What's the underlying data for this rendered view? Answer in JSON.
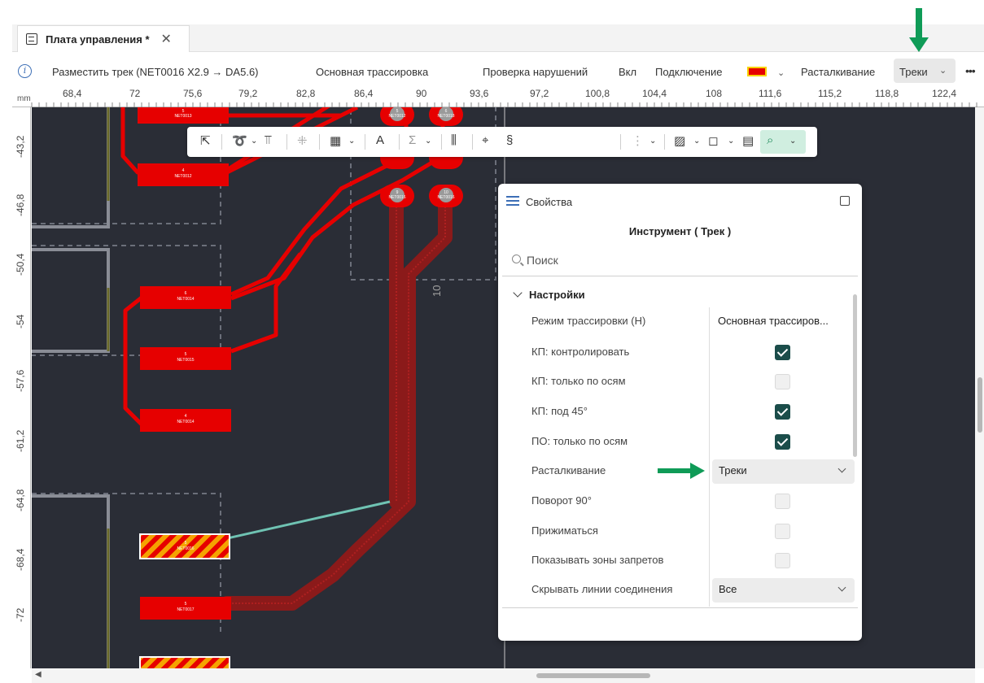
{
  "tab": {
    "title": "Плата управления *",
    "close": "✕",
    "icon": "board-document-icon"
  },
  "toolbar": {
    "info_icon": "i",
    "place_track": "Разместить трек (NET0016 X2.9 → DA5.6)",
    "routing_mode": "Основная трассировка",
    "violation_check": "Проверка нарушений",
    "violation_state": "Вкл",
    "connection": "Подключение",
    "connection_color": "#e60000",
    "shove": "Расталкивание",
    "shove_value": "Треки",
    "more": "•••"
  },
  "ruler": {
    "unit": "mm",
    "x_labels": [
      "68,4",
      "72",
      "75,6",
      "79,2",
      "82,8",
      "86,4",
      "90",
      "93,6",
      "97,2",
      "100,8",
      "104,4",
      "108",
      "111,6",
      "115,2",
      "118,8",
      "122,4"
    ],
    "y_labels": [
      "-43,2",
      "-46,8",
      "-50,4",
      "-54",
      "-57,6",
      "-61,2",
      "-64,8",
      "-68,4",
      "-72"
    ]
  },
  "pcb": {
    "pads": [
      {
        "num": "5",
        "net": "NET0013"
      },
      {
        "num": "4",
        "net": "NET0012"
      },
      {
        "num": "6",
        "net": "NET0014"
      },
      {
        "num": "5",
        "net": "NET0015"
      },
      {
        "num": "4",
        "net": "NET0014"
      },
      {
        "num": "5",
        "net": "NET0016"
      },
      {
        "num": "5",
        "net": "NET0017"
      }
    ],
    "round_pads": [
      {
        "num": "5",
        "net": "NET0012"
      },
      {
        "num": "6",
        "net": "NET0018"
      },
      {
        "num": "9",
        "net": "NET0016"
      },
      {
        "num": "10",
        "net": "NET0016"
      }
    ],
    "ref_label": "10",
    "colors": {
      "track": "#e60000",
      "board": "#2a2d36",
      "route": "#8b1a1a",
      "ratsnest": "#6fc3b3"
    }
  },
  "props": {
    "title": "Свойства",
    "header": "Инструмент ( Трек )",
    "search_placeholder": "Поиск",
    "section": "Настройки",
    "rows": [
      {
        "label": "Режим трассировки (H)",
        "value": "Основная трассиров..."
      },
      {
        "label": "КП: контролировать",
        "checked": true
      },
      {
        "label": "КП: только по осям",
        "checked": false
      },
      {
        "label": "КП: под 45°",
        "checked": true
      },
      {
        "label": "ПО: только по осям",
        "checked": true
      },
      {
        "label": "Расталкивание",
        "dropdown": "Треки"
      },
      {
        "label": "Поворот 90°",
        "checked": false
      },
      {
        "label": "Прижиматься",
        "checked": false
      },
      {
        "label": "Показывать зоны запретов",
        "checked": false
      },
      {
        "label": "Скрывать линии соединения",
        "dropdown": "Все"
      }
    ]
  },
  "accent": "#0f9b57"
}
